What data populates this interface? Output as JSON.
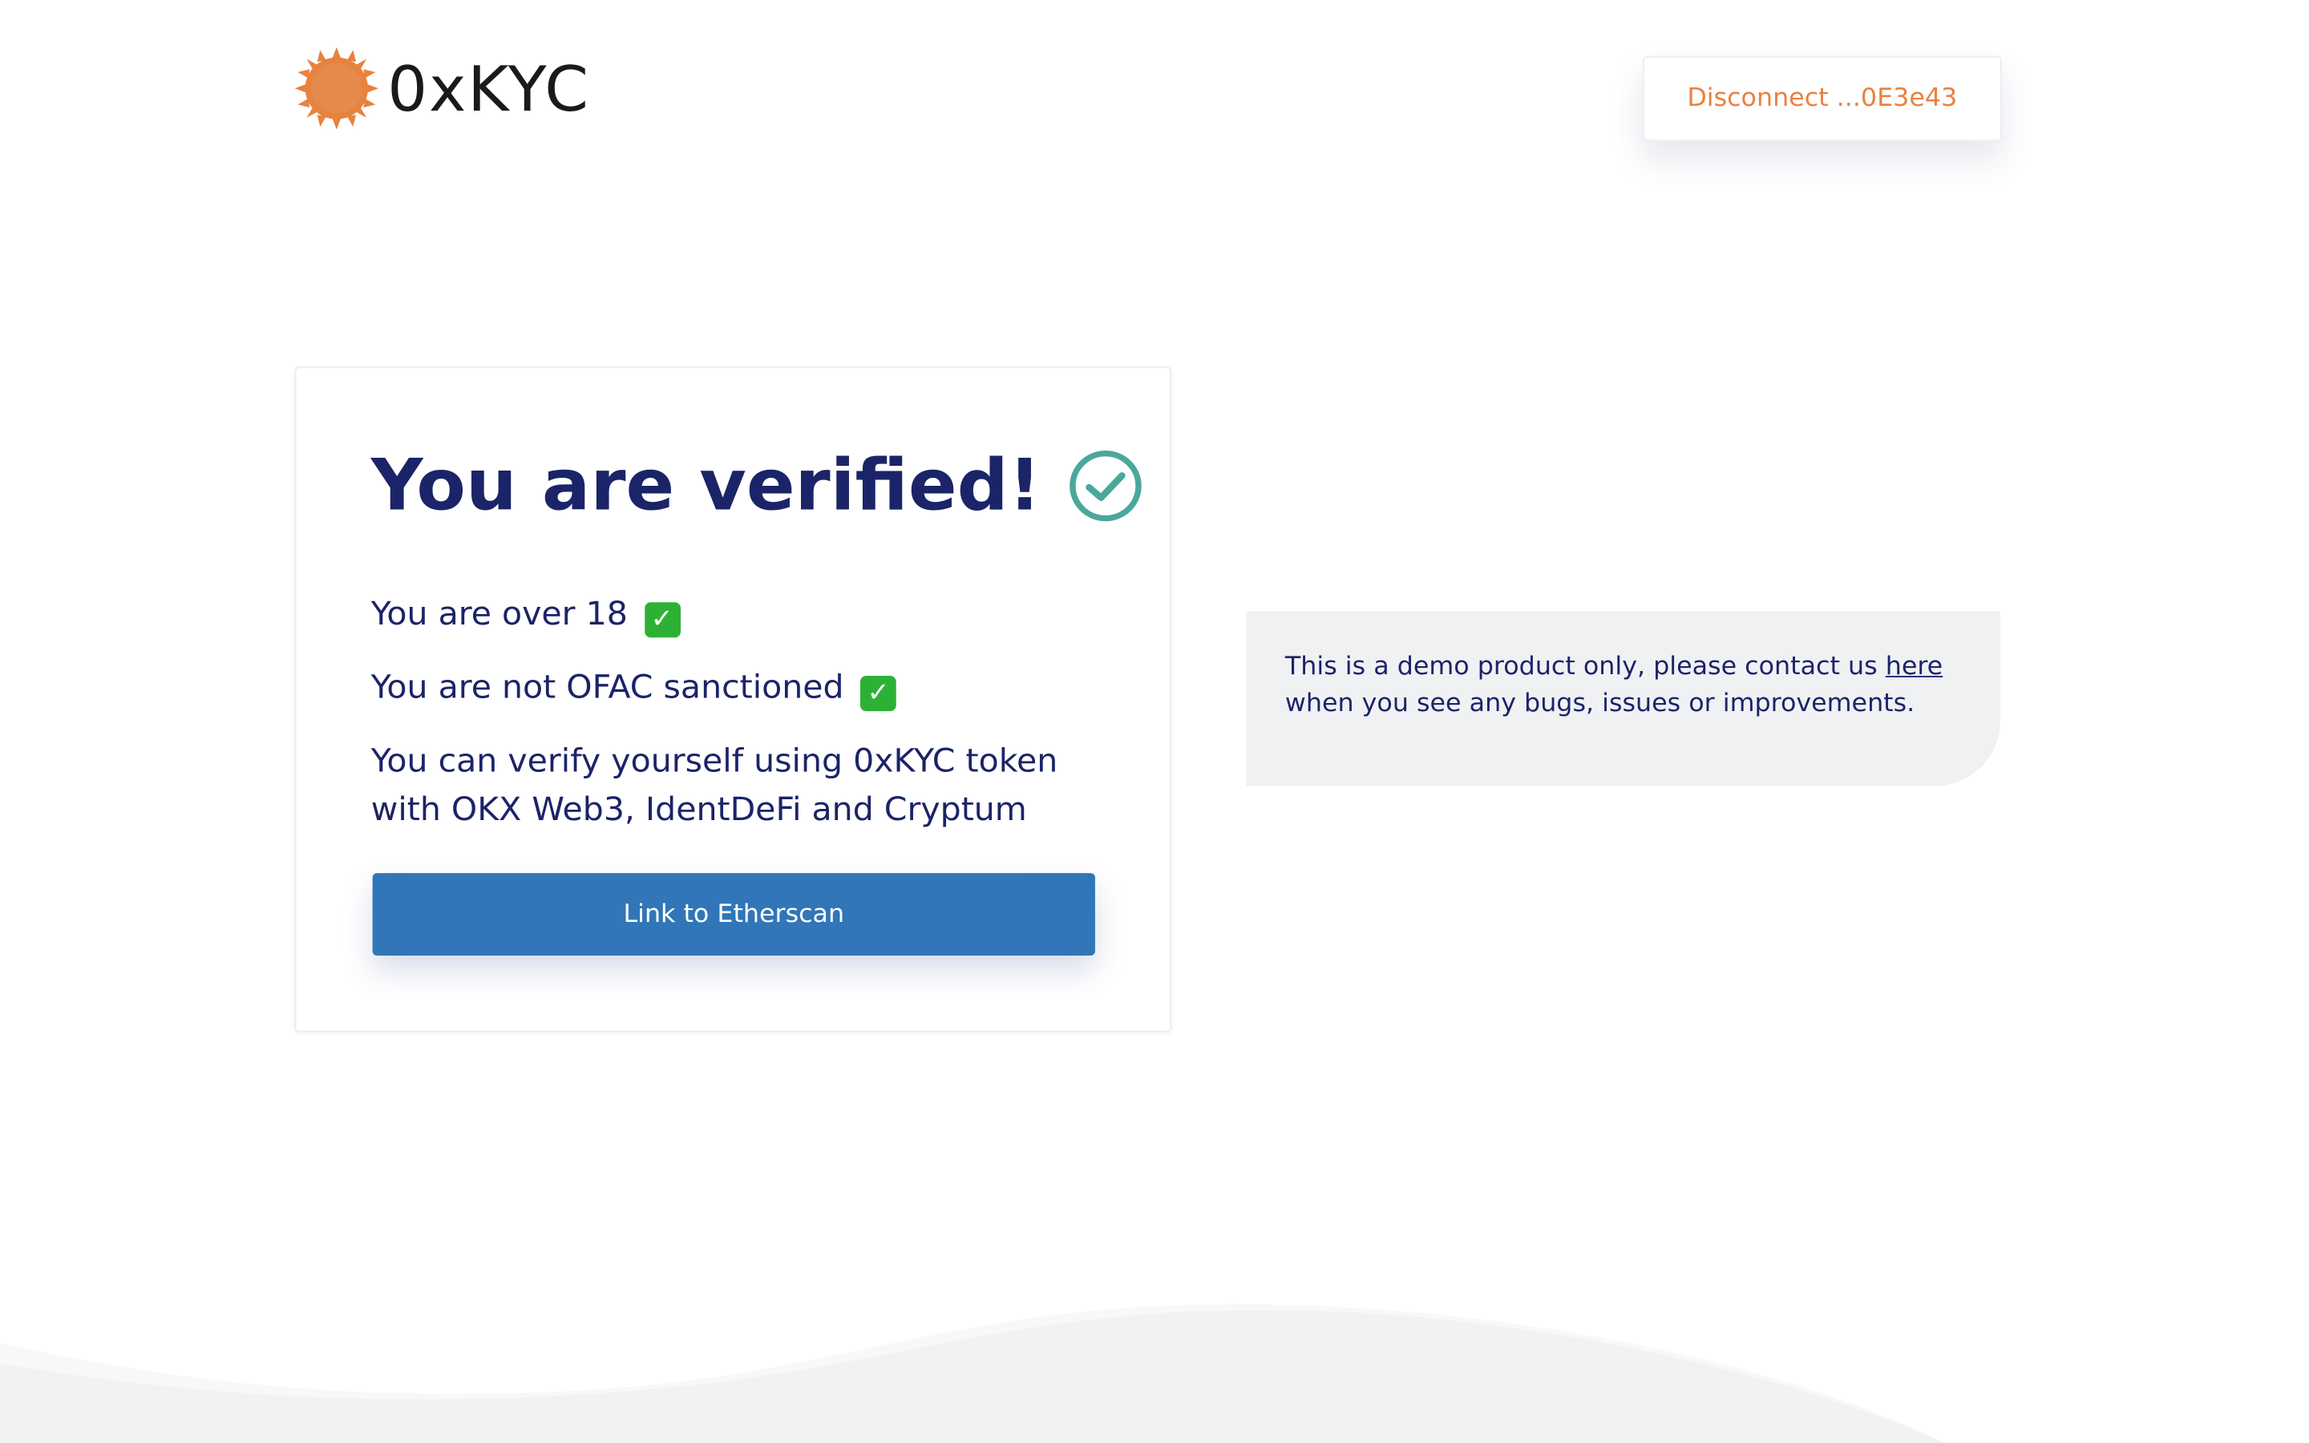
{
  "header": {
    "logo_text": "0xKYC",
    "logo_icon": "sun-icon",
    "disconnect_label": "Disconnect ...0E3e43"
  },
  "card": {
    "title": "You are verified!",
    "title_icon": "check-circle-icon",
    "checks": [
      {
        "text": "You are over 18",
        "icon": "check-mark-emoji"
      },
      {
        "text": "You are not OFAC sanctioned",
        "icon": "check-mark-emoji"
      }
    ],
    "description": "You can verify yourself using 0xKYC token with OKX Web3, IdentDeFi and Cryptum",
    "button_label": "Link to Etherscan"
  },
  "note": {
    "text_before": "This is a demo product only, please contact us ",
    "link_text": "here",
    "text_after": " when you see any bugs, issues or improvements."
  },
  "colors": {
    "primary_text": "#1b2468",
    "accent_orange": "#e8823f",
    "button_blue": "#3076b8",
    "check_teal": "#4aa89a",
    "note_bg": "#f0f1f3"
  }
}
